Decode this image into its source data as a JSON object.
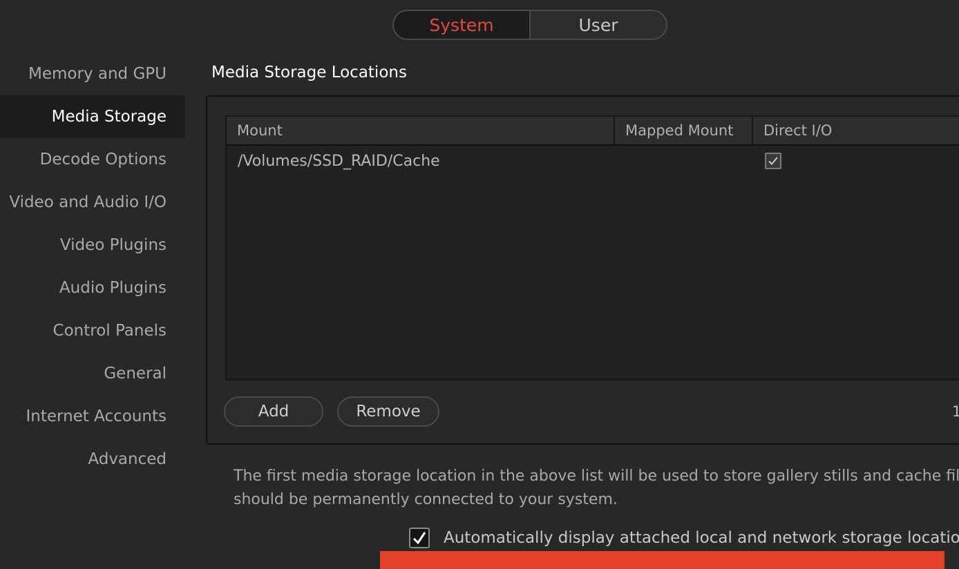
{
  "tabs": [
    {
      "label": "System",
      "active": true
    },
    {
      "label": "User",
      "active": false
    }
  ],
  "sidebar": {
    "items": [
      {
        "label": "Memory and GPU"
      },
      {
        "label": "Media Storage"
      },
      {
        "label": "Decode Options"
      },
      {
        "label": "Video and Audio I/O"
      },
      {
        "label": "Video Plugins"
      },
      {
        "label": "Audio Plugins"
      },
      {
        "label": "Control Panels"
      },
      {
        "label": "General"
      },
      {
        "label": "Internet Accounts"
      },
      {
        "label": "Advanced"
      }
    ],
    "active_index": 1
  },
  "main": {
    "title": "Media Storage Locations",
    "table": {
      "columns": [
        "Mount",
        "Mapped Mount",
        "Direct I/O"
      ],
      "rows": [
        {
          "mount": "/Volumes/SSD_RAID/Cache",
          "mapped_mount": "",
          "direct_io": true
        }
      ]
    },
    "add_label": "Add",
    "remove_label": "Remove",
    "page_indicator": "1",
    "info_line1": "The first media storage location in the above list will be used to store gallery stills and cache file",
    "info_line2": "should be permanently connected to your system.",
    "auto_display": {
      "checked": true,
      "label": "Automatically display attached local and network storage locations"
    }
  },
  "colors": {
    "accent": "#e6493c",
    "background": "#282828",
    "active_background": "#1c1c1c",
    "bottom_bar": "#e6402a"
  },
  "icons": {
    "direct_io_checkbox": "check-icon",
    "auto_display_checkbox": "check-icon"
  }
}
